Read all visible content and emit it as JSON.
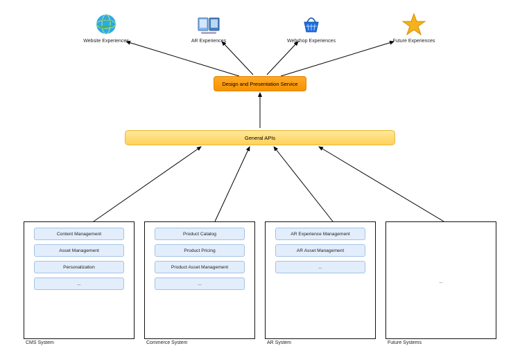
{
  "experiences": [
    {
      "label": "Website Experiences",
      "icon": "globe"
    },
    {
      "label": "AR Experiences",
      "icon": "ar"
    },
    {
      "label": "Webshop Experiences",
      "icon": "basket"
    },
    {
      "label": "Future Experiences",
      "icon": "star"
    }
  ],
  "design_service": {
    "label": "Design and Presentation Service"
  },
  "general_apis": {
    "label": "General APIs"
  },
  "systems": [
    {
      "name": "CMS System",
      "services": [
        "Content Management",
        "Asset Management",
        "Personalization",
        "..."
      ]
    },
    {
      "name": "Commerce System",
      "services": [
        "Product Catalog",
        "Product Pricing",
        "Product Asset Management",
        "..."
      ]
    },
    {
      "name": "AR System",
      "services": [
        "AR Experience Management",
        "AR Asset Management",
        "..."
      ]
    },
    {
      "name": "Future Systems",
      "services": [
        "..."
      ]
    }
  ],
  "colors": {
    "orange": "#f79400",
    "yellow": "#ffd25a",
    "service": "#e2eefb"
  }
}
